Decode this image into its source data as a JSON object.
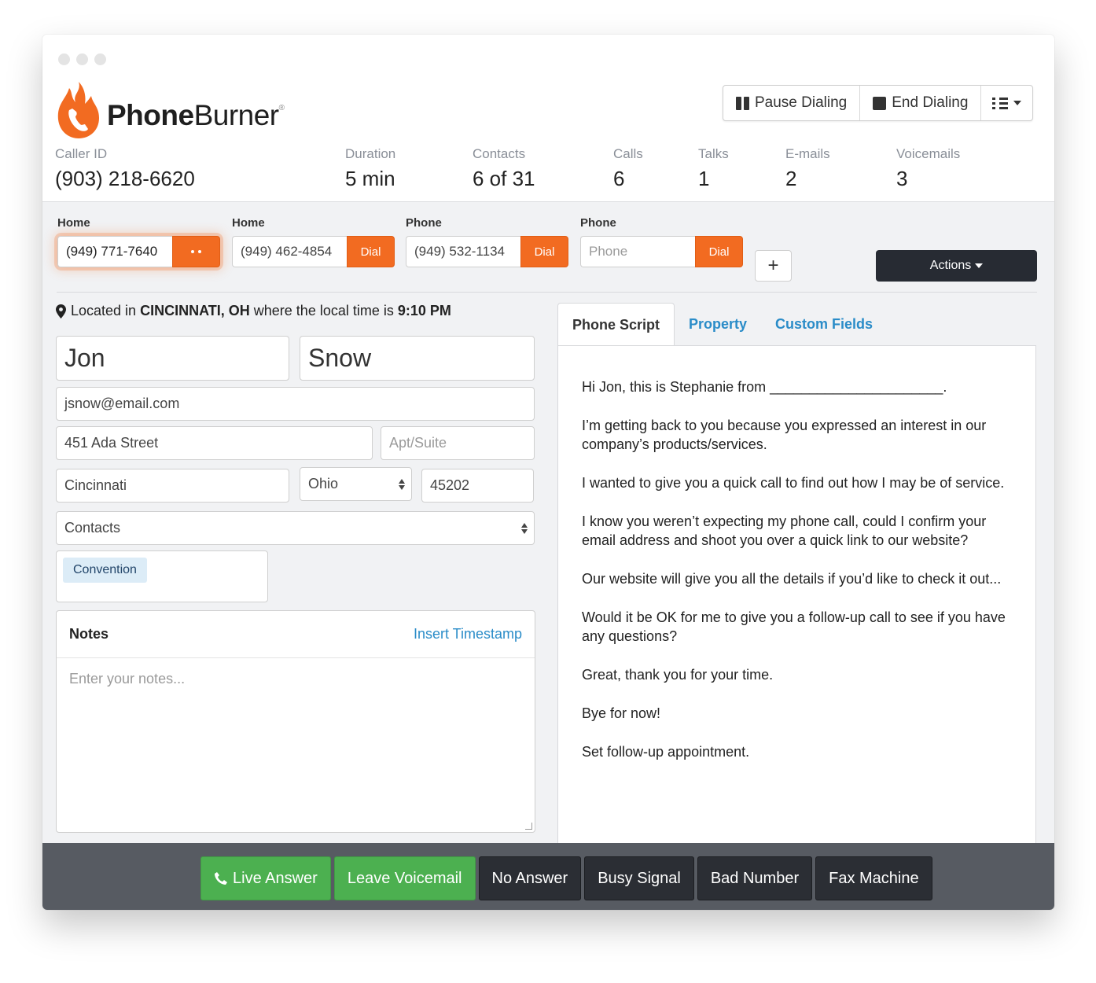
{
  "brand": {
    "name_bold": "Phone",
    "name_light": "Burner",
    "reg": "®"
  },
  "toolbar": {
    "pause_label": "Pause Dialing",
    "end_label": "End Dialing"
  },
  "stats": [
    {
      "label": "Caller ID",
      "value": "(903) 218-6620"
    },
    {
      "label": "Duration",
      "value": "5 min"
    },
    {
      "label": "Contacts",
      "value": "6 of 31"
    },
    {
      "label": "Calls",
      "value": "6"
    },
    {
      "label": "Talks",
      "value": "1"
    },
    {
      "label": "E-mails",
      "value": "2"
    },
    {
      "label": "Voicemails",
      "value": "3"
    }
  ],
  "phones": [
    {
      "label": "Home",
      "value": "(949) 771-7640",
      "button": ""
    },
    {
      "label": "Home",
      "value": "(949) 462-4854",
      "button": "Dial"
    },
    {
      "label": "Phone",
      "value": "(949) 532-1134",
      "button": "Dial"
    },
    {
      "label": "Phone",
      "placeholder": "Phone",
      "button": "Dial"
    }
  ],
  "add_phone_label": "+",
  "actions_label": "Actions",
  "location": {
    "prefix": "Located in",
    "city": "CINCINNATI, OH",
    "middle": "where the local time is",
    "time": "9:10 PM"
  },
  "contact": {
    "first_name": "Jon",
    "last_name": "Snow",
    "email": "jsnow@email.com",
    "street": "451 Ada Street",
    "apt_placeholder": "Apt/Suite",
    "city": "Cincinnati",
    "state": "Ohio",
    "zip": "45202",
    "folder": "Contacts",
    "tag": "Convention"
  },
  "notes": {
    "title": "Notes",
    "insert_timestamp": "Insert Timestamp",
    "placeholder": "Enter your notes..."
  },
  "tabs": [
    "Phone Script",
    "Property",
    "Custom Fields"
  ],
  "script": [
    "Hi Jon, this is Stephanie from ______________________.",
    "I’m getting back to you because you expressed an interest in our company’s products/services.",
    "I wanted to give you a quick call to find out how I may be of service.",
    "I know you weren’t expecting my phone call, could I confirm your email address and shoot you over a quick link to our website?",
    "Our website will give you all the details if you’d like to check it out...",
    "Would it be OK for me to give you a follow-up call to see if you have any questions?",
    "Great, thank you for your time.",
    "Bye for now!",
    "Set follow-up appointment."
  ],
  "outcomes": [
    "Live Answer",
    "Leave Voicemail",
    "No Answer",
    "Busy Signal",
    "Bad Number",
    "Fax Machine"
  ],
  "colors": {
    "accent": "#f26b21",
    "link": "#2a8cc8",
    "success": "#4cb050",
    "dark": "#272b33"
  }
}
